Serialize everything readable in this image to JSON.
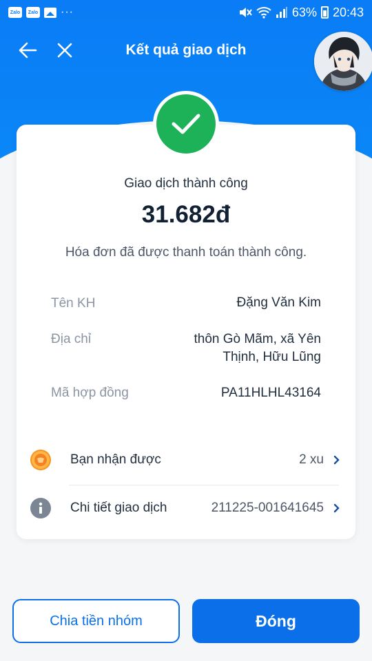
{
  "statusbar": {
    "app_icon_1": "Zalo",
    "app_icon_2": "Zalo",
    "more": "···",
    "battery_percent": "63%",
    "time": "20:43"
  },
  "header": {
    "title": "Kết quả giao dịch",
    "accent_color": "#0a7cf5"
  },
  "result": {
    "status": "Giao dịch thành công",
    "amount": "31.682đ",
    "message": "Hóa đơn đã được thanh toán thành công.",
    "success_color": "#1db257"
  },
  "details": [
    {
      "label": "Tên KH",
      "value": "Đặng Văn Kim"
    },
    {
      "label": "Địa chỉ",
      "value_line1": "thôn Gò Mãm, xã Yên",
      "value_line2": "Thịnh, Hữu Lũng"
    },
    {
      "label": "Mã hợp đồng",
      "value": "PA11HLHL43164"
    }
  ],
  "actions": [
    {
      "label": "Bạn nhận được",
      "value": "2 xu",
      "icon": "coin-icon"
    },
    {
      "label": "Chi tiết giao dịch",
      "value": "211225-001641645",
      "icon": "info-icon"
    }
  ],
  "buttons": {
    "split": "Chia tiền nhóm",
    "close": "Đóng"
  }
}
